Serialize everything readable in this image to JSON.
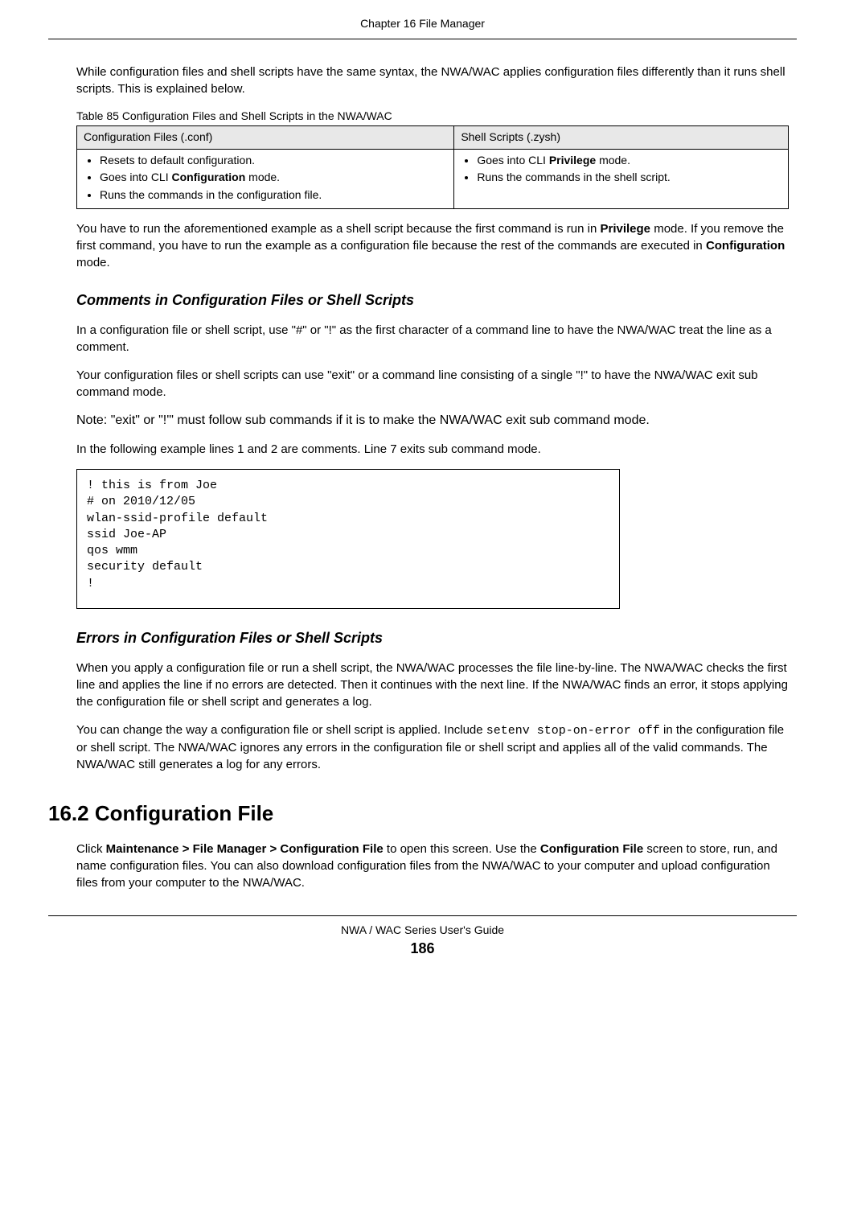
{
  "header": {
    "chapter": "Chapter 16 File Manager"
  },
  "intro_para": "While configuration files and shell scripts have the same syntax, the NWA/WAC applies configuration files differently than it runs shell scripts. This is explained below.",
  "table": {
    "caption": "Table 85   Configuration Files and Shell Scripts in the NWA/WAC",
    "header_left": "Configuration Files (.conf)",
    "header_right": "Shell Scripts (.zysh)",
    "left_items": {
      "i1": "Resets to default configuration.",
      "i2_pre": "Goes into CLI ",
      "i2_bold": "Configuration",
      "i2_post": " mode.",
      "i3": "Runs the commands in the configuration file."
    },
    "right_items": {
      "i1_pre": "Goes into CLI ",
      "i1_bold": "Privilege",
      "i1_post": " mode.",
      "i2": "Runs the commands in the shell script."
    }
  },
  "after_table": {
    "p1_a": "You have to run the aforementioned example as a shell script because the first command is run in ",
    "p1_b": "Privilege",
    "p1_c": " mode. If you remove the first command, you have to run the example as a configuration file because the rest of the commands are executed in ",
    "p1_d": "Configuration",
    "p1_e": " mode."
  },
  "comments_section": {
    "heading": "Comments in Configuration Files or Shell Scripts",
    "p1": "In a configuration file or shell script, use \"#\" or \"!\" as the first character of a command line to have the NWA/WAC treat the line as a comment.",
    "p2": "Your configuration files or shell scripts can use \"exit\" or a command line consisting of a single \"!\" to have the NWA/WAC exit sub command mode.",
    "note": "Note: \"exit\" or \"!'\" must follow sub commands if it is to make the NWA/WAC exit sub command mode.",
    "p3": "In the following example lines 1 and 2 are comments. Line 7 exits sub command mode."
  },
  "code_example": "! this is from Joe\n# on 2010/12/05\nwlan-ssid-profile default\nssid Joe-AP\nqos wmm\nsecurity default\n!",
  "errors_section": {
    "heading": "Errors in Configuration Files or Shell Scripts",
    "p1": "When you apply a configuration file or run a shell script, the NWA/WAC processes the file line-by-line. The NWA/WAC checks the first line and applies the line if no errors are detected. Then it continues with the next line. If the NWA/WAC finds an error, it stops applying the configuration file or shell script and generates a log.",
    "p2_a": "You can change the way a configuration file or shell script is applied. Include ",
    "p2_code": "setenv stop-on-error off",
    "p2_b": " in the configuration file or shell script. The NWA/WAC ignores any errors in the configuration file or shell script and applies all of the valid commands. The NWA/WAC still generates a log for any errors."
  },
  "config_section": {
    "heading": "16.2  Configuration File",
    "p1_a": "Click ",
    "p1_b": "Maintenance > File Manager > Configuration File",
    "p1_c": " to open this screen. Use the ",
    "p1_d": "Configuration File",
    "p1_e": " screen to store, run, and name configuration files. You can also download configuration files from the NWA/WAC to your computer and upload configuration files from your computer to the NWA/WAC."
  },
  "footer": {
    "guide": "NWA / WAC Series User's Guide",
    "page": "186"
  }
}
